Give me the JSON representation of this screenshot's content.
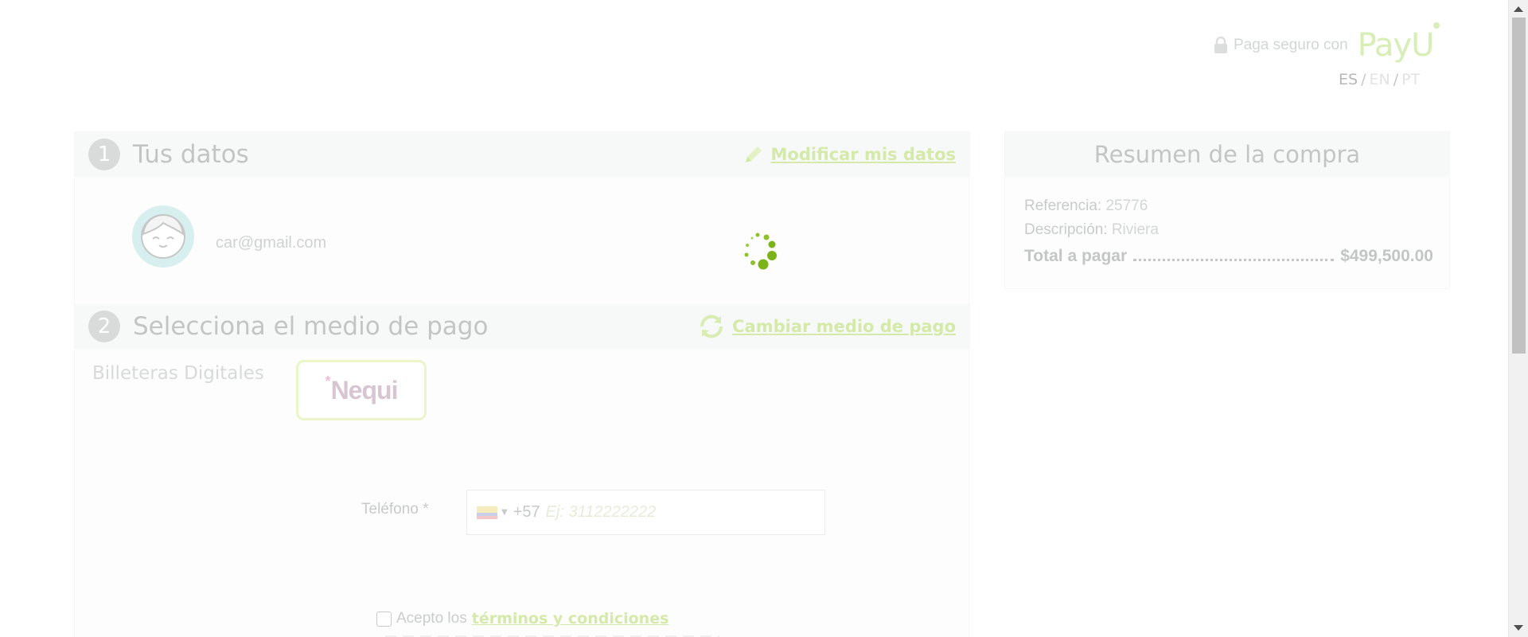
{
  "header": {
    "secure_text": "Paga seguro con",
    "brand": "PayU",
    "languages": [
      "ES",
      "EN",
      "PT"
    ],
    "active_language": "ES"
  },
  "step1": {
    "number": "1",
    "title": "Tus datos",
    "action_label": "Modificar mis datos",
    "user_email": "car@gmail.com"
  },
  "step2": {
    "number": "2",
    "title": "Selecciona el medio de pago",
    "action_label": "Cambiar medio de pago",
    "category_label": "Billeteras Digitales",
    "method_star": "*",
    "method_name": "Nequi",
    "phone": {
      "label": "Teléfono *",
      "dial_code": "+57",
      "placeholder": "Ej: 3112222222"
    },
    "terms": {
      "prefix": "Acepto los",
      "link": "términos y condiciones"
    }
  },
  "summary": {
    "title": "Resumen de la compra",
    "reference_label": "Referencia:",
    "reference_value": "25776",
    "description_label": "Descripción:",
    "description_value": "Riviera",
    "total_label": "Total a pagar",
    "total_value": "$499,500.00"
  },
  "colors": {
    "accent": "#a3d53a",
    "spinner": "#7cb31a"
  },
  "icons": [
    "lock-icon",
    "pencil-icon",
    "refresh-icon",
    "avatar-icon",
    "loading-spinner-icon",
    "colombia-flag-icon"
  ]
}
